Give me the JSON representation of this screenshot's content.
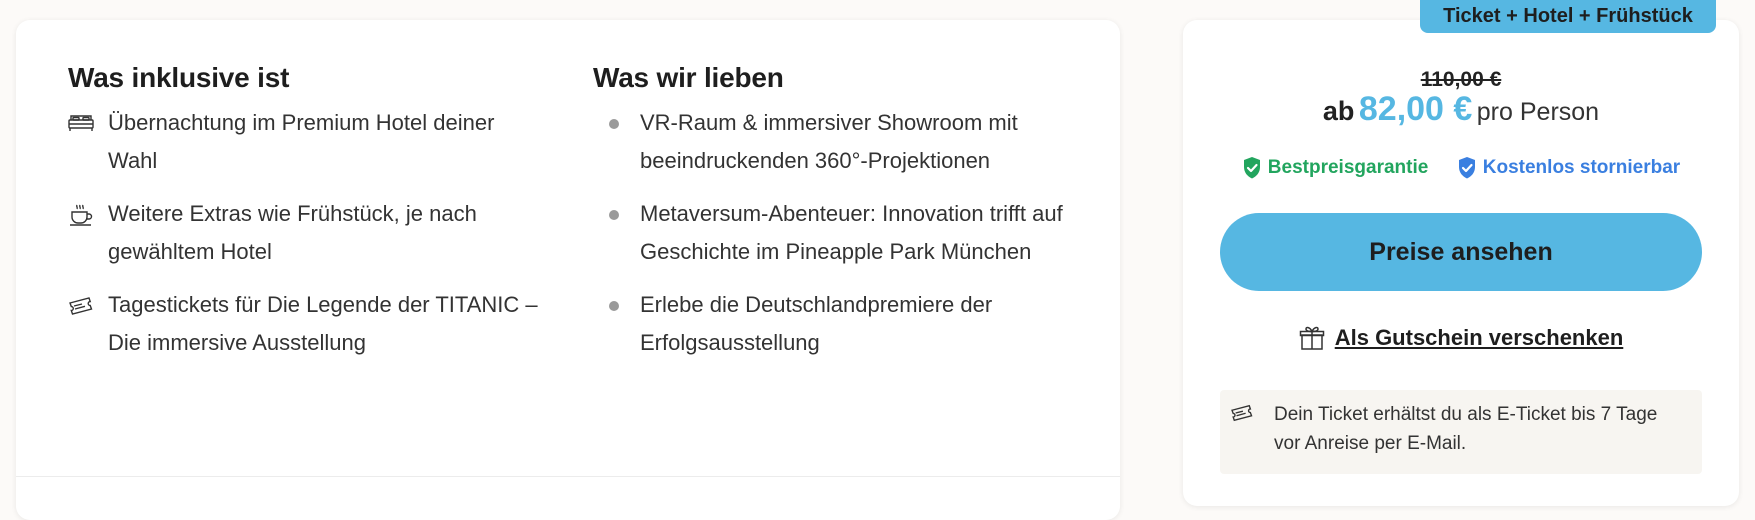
{
  "included": {
    "heading": "Was inklusive ist",
    "items": [
      {
        "icon": "bed-icon",
        "text": "Übernachtung im Premium Hotel deiner Wahl"
      },
      {
        "icon": "coffee-cup-icon",
        "text": "Weitere Extras wie Frühstück, je nach gewähltem Hotel"
      },
      {
        "icon": "ticket-icon",
        "text": "Tagestickets für Die Legende der TITANIC – Die immersive Ausstellung"
      }
    ]
  },
  "loved": {
    "heading": "Was wir lieben",
    "items": [
      "VR-Raum & immersiver Showroom mit beeindruckenden 360°-Projektionen",
      "Metaversum-Abenteuer: Innovation trifft auf Geschichte im Pineapple Park München",
      "Erlebe die Deutschlandpremiere der Erfolgsausstellung"
    ]
  },
  "offer": {
    "badge": "Ticket + Hotel + Frühstück",
    "old_price": "110,00 €",
    "price_prefix": "ab",
    "price": "82,00 €",
    "price_suffix": "pro Person",
    "guarantee_best": "Bestpreisgarantie",
    "guarantee_free": "Kostenlos stornierbar",
    "cta_label": "Preise ansehen",
    "gift_label": "Als Gutschein verschenken",
    "info_text": "Dein Ticket erhältst du als E-Ticket bis 7 Tage vor Anreise per E-Mail."
  },
  "colors": {
    "accent": "#56b7e2",
    "green": "#22a55e",
    "blue": "#3a7fe0"
  }
}
